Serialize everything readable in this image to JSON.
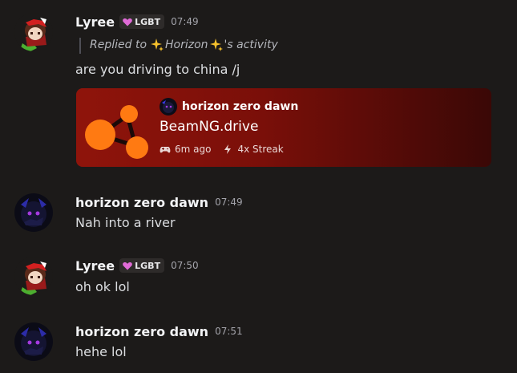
{
  "colors": {
    "background": "#1c1a19",
    "card_accent": "#8f140b",
    "tag_heart": "#e06bd7",
    "game_icon": "#ff7a12"
  },
  "messages": [
    {
      "username": "Lyree",
      "tag": "LGBT",
      "tag_icon": "purple-heart-icon",
      "time": "07:49",
      "reply": {
        "prefix": "Replied to",
        "name": "Horizon",
        "suffix": "'s activity",
        "emoji": "sparkles-icon"
      },
      "text": "are you driving to china /j",
      "activity_card": {
        "username": "horizon zero dawn",
        "game": "BeamNG.drive",
        "elapsed": "6m ago",
        "streak": "4x Streak",
        "elapsed_icon": "gamepad-icon",
        "streak_icon": "lightning-icon"
      }
    },
    {
      "username": "horizon zero dawn",
      "time": "07:49",
      "text": "Nah into a river"
    },
    {
      "username": "Lyree",
      "tag": "LGBT",
      "tag_icon": "purple-heart-icon",
      "time": "07:50",
      "text": "oh ok lol"
    },
    {
      "username": "horizon zero dawn",
      "time": "07:51",
      "text": "hehe lol"
    }
  ]
}
